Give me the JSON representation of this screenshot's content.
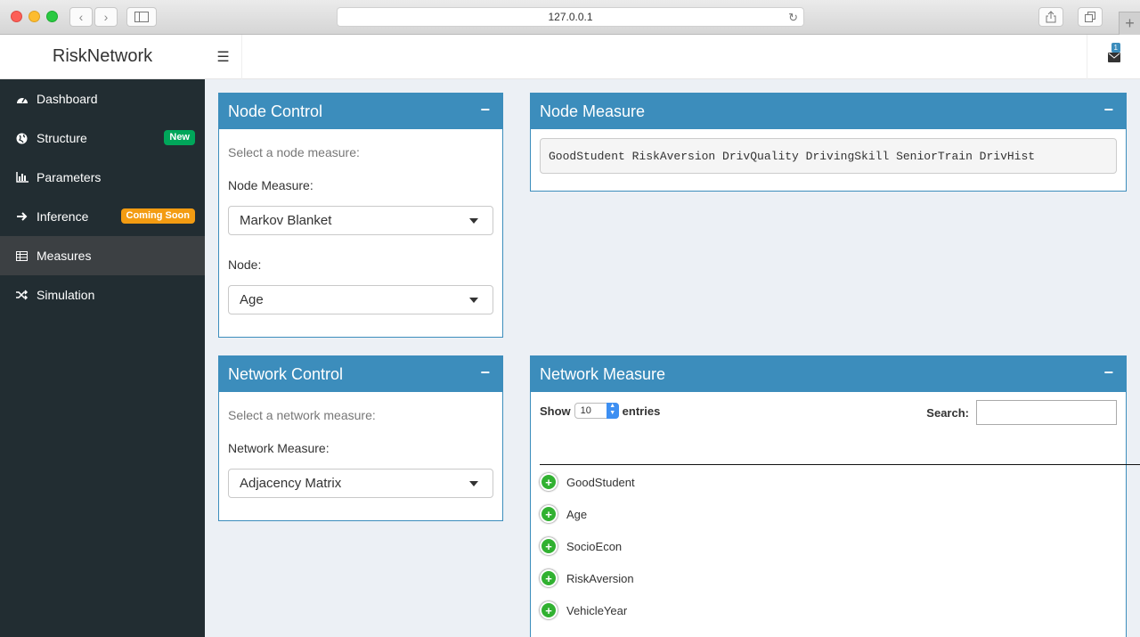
{
  "browser": {
    "url": "127.0.0.1"
  },
  "app": {
    "title": "RiskNetwork",
    "mail_count": "1"
  },
  "sidebar": {
    "items": [
      {
        "label": "Dashboard",
        "icon": "dashboard-icon"
      },
      {
        "label": "Structure",
        "icon": "globe-icon",
        "badge": "New"
      },
      {
        "label": "Parameters",
        "icon": "bar-chart-icon"
      },
      {
        "label": "Inference",
        "icon": "arrow-right-icon",
        "badge": "Coming Soon"
      },
      {
        "label": "Measures",
        "icon": "table-icon",
        "active": true
      },
      {
        "label": "Simulation",
        "icon": "shuffle-icon"
      }
    ]
  },
  "node_control": {
    "title": "Node Control",
    "help": "Select a node measure:",
    "measure_label": "Node Measure:",
    "measure_value": "Markov Blanket",
    "node_label": "Node:",
    "node_value": "Age"
  },
  "node_measure": {
    "title": "Node Measure",
    "output": "GoodStudent RiskAversion DrivQuality DrivingSkill SeniorTrain DrivHist"
  },
  "network_control": {
    "title": "Network Control",
    "help": "Select a network measure:",
    "measure_label": "Network Measure:",
    "measure_value": "Adjacency Matrix"
  },
  "network_measure": {
    "title": "Network Measure",
    "show_label": "Show",
    "entries_value": "10",
    "entries_label": "entries",
    "search_label": "Search:",
    "rows": [
      "GoodStudent",
      "Age",
      "SocioEcon",
      "RiskAversion",
      "VehicleYear"
    ]
  },
  "collapse_symbol": "−"
}
